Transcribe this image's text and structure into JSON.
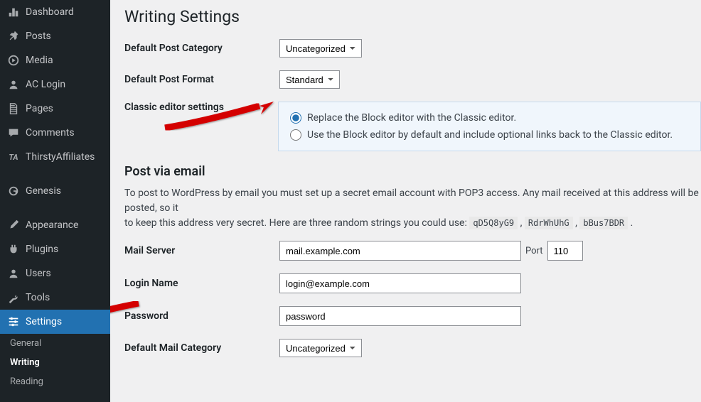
{
  "sidebar": {
    "items": [
      {
        "label": "Dashboard",
        "icon": "dashboard-icon"
      },
      {
        "label": "Posts",
        "icon": "pin-icon"
      },
      {
        "label": "Media",
        "icon": "media-icon"
      },
      {
        "label": "AC Login",
        "icon": "user-icon"
      },
      {
        "label": "Pages",
        "icon": "pages-icon"
      },
      {
        "label": "Comments",
        "icon": "comment-icon"
      },
      {
        "label": "ThirstyAffiliates",
        "icon": "ta-icon"
      },
      {
        "label": "Genesis",
        "icon": "genesis-icon"
      },
      {
        "label": "Appearance",
        "icon": "brush-icon"
      },
      {
        "label": "Plugins",
        "icon": "plugin-icon"
      },
      {
        "label": "Users",
        "icon": "users-icon"
      },
      {
        "label": "Tools",
        "icon": "wrench-icon"
      },
      {
        "label": "Settings",
        "icon": "sliders-icon"
      }
    ],
    "sub": [
      "General",
      "Writing",
      "Reading"
    ]
  },
  "page": {
    "title": "Writing Settings",
    "default_category_label": "Default Post Category",
    "default_category_value": "Uncategorized",
    "default_format_label": "Default Post Format",
    "default_format_value": "Standard",
    "classic_label": "Classic editor settings",
    "classic_opt1": "Replace the Block editor with the Classic editor.",
    "classic_opt2": "Use the Block editor by default and include optional links back to the Classic editor.",
    "post_email_heading": "Post via email",
    "post_email_desc_1": "To post to WordPress by email you must set up a secret email account with POP3 access. Any mail received at this address will be posted, so it",
    "post_email_desc_2": "to keep this address very secret. Here are three random strings you could use: ",
    "code1": "qD5Q8yG9",
    "code2": "RdrWhUhG",
    "code3": "bBus7BDR",
    "mail_server_label": "Mail Server",
    "mail_server_value": "mail.example.com",
    "port_label": "Port",
    "port_value": "110",
    "login_label": "Login Name",
    "login_value": "login@example.com",
    "password_label": "Password",
    "password_value": "password",
    "default_mail_cat_label": "Default Mail Category",
    "default_mail_cat_value": "Uncategorized"
  }
}
